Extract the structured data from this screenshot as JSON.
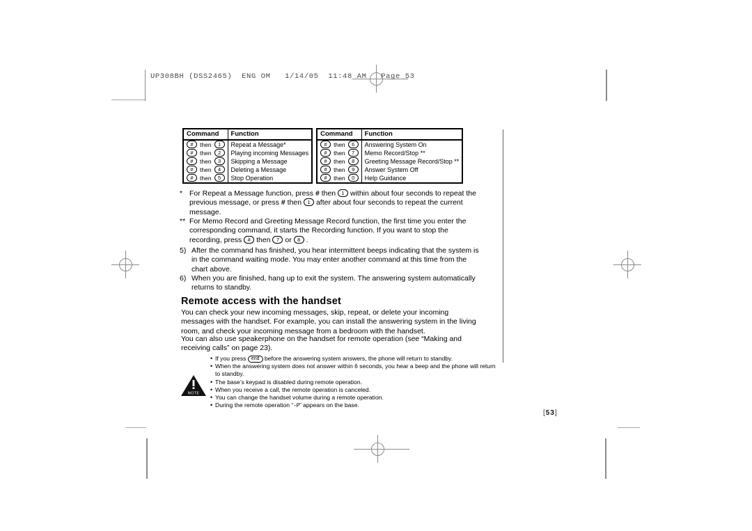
{
  "prepress": {
    "slug": "UP308BH (DSS2465)  ENG OM   1/14/05  11:48 AM   Page 53"
  },
  "tables": [
    {
      "headers": [
        "Command",
        "Function"
      ],
      "rows": [
        {
          "key": "#",
          "then": "then",
          "num": "1",
          "function": "Repeat a Message*"
        },
        {
          "key": "#",
          "then": "then",
          "num": "2",
          "function": "Playing incoming Messages"
        },
        {
          "key": "#",
          "then": "then",
          "num": "3",
          "function": "Skipping a Message"
        },
        {
          "key": "#",
          "then": "then",
          "num": "4",
          "function": "Deleting a Message"
        },
        {
          "key": "#",
          "then": "then",
          "num": "5",
          "function": "Stop Operation"
        }
      ]
    },
    {
      "headers": [
        "Command",
        "Function"
      ],
      "rows": [
        {
          "key": "#",
          "then": "then",
          "num": "6",
          "function": "Answering System On"
        },
        {
          "key": "#",
          "then": "then",
          "num": "7",
          "function": "Memo Record/Stop **"
        },
        {
          "key": "#",
          "then": "then",
          "num": "8",
          "function": "Greeting Message Record/Stop **"
        },
        {
          "key": "#",
          "then": "then",
          "num": "9",
          "function": "Answer System Off"
        },
        {
          "key": "#",
          "then": "then",
          "num": "0",
          "function": "Help Guidance"
        }
      ]
    }
  ],
  "footnotes": [
    {
      "mark": "*",
      "part1": "For Repeat a Message function, press ",
      "hash1": "#",
      "part2": " then ",
      "key1": "1",
      "part3": " within about four seconds to repeat the previous message, or press ",
      "hash2": "#",
      "part4": " then ",
      "key2": "1",
      "part5": " after about four seconds to repeat the current message."
    },
    {
      "mark": "**",
      "part1": "For Memo Record and Greeting Message Record function, the first time you enter the corresponding command, it starts the Recording function. If you want to stop the recording, press ",
      "key1": "#",
      "part2": " then ",
      "key2": "7",
      "part3": " or ",
      "key3": "8",
      "part4": " ."
    }
  ],
  "steps": [
    {
      "mark": "5)",
      "text": "After the command has finished, you hear intermittent beeps indicating that the system is in the command waiting mode. You may enter another command at this time from the chart above."
    },
    {
      "mark": "6)",
      "text": "When you are finished, hang up to exit the system. The answering system automatically returns to standby."
    }
  ],
  "section": {
    "heading": "Remote access with the handset",
    "paragraphs": [
      "You can check your new incoming messages, skip, repeat, or delete your incoming messages with the handset. For example, you can install the answering system in the living room, and check your incoming message from a bedroom with the handset.",
      "You can also use speakerphone on the handset for remote operation (see “Making and receiving calls” on page 23)."
    ]
  },
  "note": {
    "icon_label": "NOTE",
    "icon_symbol": "!",
    "bullets": [
      {
        "pre": "If you press ",
        "key": "end",
        "post": " before the answering system answers, the phone will return to standby."
      },
      {
        "pre": "When the answering system does not answer within 6 seconds, you hear a beep and the phone will return to standby.",
        "key": "",
        "post": ""
      },
      {
        "pre": "The base’s keypad is disabled during remote operation.",
        "key": "",
        "post": ""
      },
      {
        "pre": "When you receive a call, the remote operation is canceled.",
        "key": "",
        "post": ""
      },
      {
        "pre": "You can change the handset volume during a remote operation.",
        "key": "",
        "post": ""
      },
      {
        "pre": "During the remote operation “",
        "lcd": "-P",
        "post": "” appears on the base."
      }
    ]
  },
  "page_number": {
    "open": "[",
    "value": "53",
    "close": "]"
  }
}
